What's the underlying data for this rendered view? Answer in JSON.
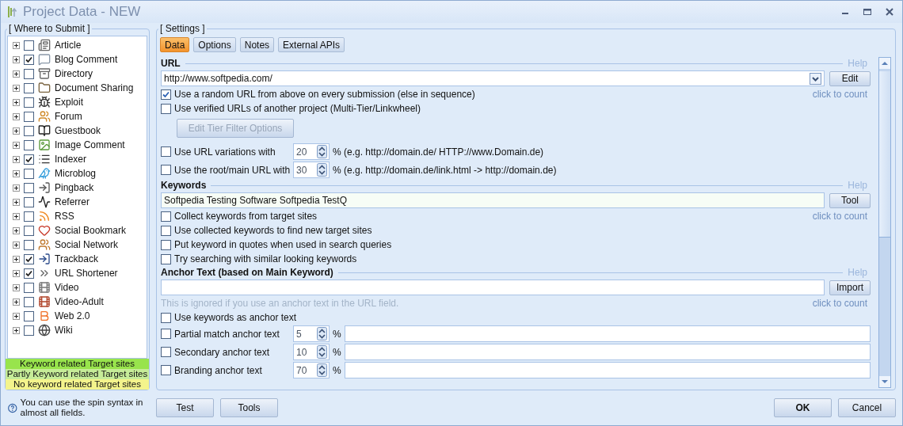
{
  "window": {
    "title": "Project Data - NEW"
  },
  "submit_panel": {
    "title": "[ Where to Submit ]",
    "items": [
      {
        "label": "Article",
        "checked": false
      },
      {
        "label": "Blog Comment",
        "checked": true
      },
      {
        "label": "Directory",
        "checked": false
      },
      {
        "label": "Document Sharing",
        "checked": false
      },
      {
        "label": "Exploit",
        "checked": false
      },
      {
        "label": "Forum",
        "checked": false
      },
      {
        "label": "Guestbook",
        "checked": false
      },
      {
        "label": "Image Comment",
        "checked": false
      },
      {
        "label": "Indexer",
        "checked": true
      },
      {
        "label": "Microblog",
        "checked": false
      },
      {
        "label": "Pingback",
        "checked": false
      },
      {
        "label": "Referrer",
        "checked": false
      },
      {
        "label": "RSS",
        "checked": false
      },
      {
        "label": "Social Bookmark",
        "checked": false
      },
      {
        "label": "Social Network",
        "checked": false
      },
      {
        "label": "Trackback",
        "checked": true
      },
      {
        "label": "URL Shortener",
        "checked": true
      },
      {
        "label": "Video",
        "checked": false
      },
      {
        "label": "Video-Adult",
        "checked": false
      },
      {
        "label": "Web 2.0",
        "checked": false
      },
      {
        "label": "Wiki",
        "checked": false
      }
    ]
  },
  "legend": [
    {
      "label": "Keyword related Target sites",
      "color": "#98e44c"
    },
    {
      "label": "Partly Keyword related Target sites",
      "color": "#c6ec98"
    },
    {
      "label": "No keyword related Target sites",
      "color": "#f4f48c"
    }
  ],
  "hint": "You can use the spin syntax in almost all fields.",
  "settings": {
    "title": "[ Settings ]",
    "tabs": [
      {
        "label": "Data",
        "selected": true
      },
      {
        "label": "Options",
        "selected": false
      },
      {
        "label": "Notes",
        "selected": false
      },
      {
        "label": "External APIs",
        "selected": false
      }
    ],
    "url": {
      "heading": "URL",
      "help": "Help",
      "value": "http://www.softpedia.com/",
      "button": "Edit",
      "count": "click to count"
    },
    "url_options": [
      {
        "label": "Use a random URL from above on every submission (else in sequence)",
        "checked": true
      },
      {
        "label": "Use verified URLs of another project (Multi-Tier/Linkwheel)",
        "checked": false
      }
    ],
    "tier_button": {
      "label": "Edit Tier Filter Options",
      "disabled": true
    },
    "url_percent": [
      {
        "label": "Use URL variations with",
        "checked": false,
        "value": "20",
        "note": "% (e.g. http://domain.de/ HTTP://www.Domain.de)"
      },
      {
        "label": "Use the root/main URL with",
        "checked": false,
        "value": "30",
        "note": "% (e.g. http://domain.de/link.html -> http://domain.de)"
      }
    ],
    "keywords": {
      "heading": "Keywords",
      "help": "Help",
      "value": "Softpedia Testing Software Softpedia TestQ",
      "button": "Tool",
      "count": "click to count"
    },
    "keyword_options": [
      {
        "label": "Collect keywords from target sites",
        "checked": false
      },
      {
        "label": "Use collected keywords to find new target sites",
        "checked": false
      },
      {
        "label": "Put keyword in quotes when used in search queries",
        "checked": false
      },
      {
        "label": "Try searching with similar looking keywords",
        "checked": false
      }
    ],
    "anchor": {
      "heading": "Anchor Text (based on Main Keyword)",
      "help": "Help",
      "button": "Import",
      "note": "This is ignored if you use an anchor text in the URL field.",
      "count": "click to count"
    },
    "anchor_option": {
      "label": "Use keywords as anchor text",
      "checked": false
    },
    "anchor_rows": [
      {
        "label": "Partial match anchor text",
        "checked": false,
        "value": "5",
        "unit": "%"
      },
      {
        "label": "Secondary anchor text",
        "checked": false,
        "value": "10",
        "unit": "%"
      },
      {
        "label": "Branding anchor text",
        "checked": false,
        "value": "70",
        "unit": "%"
      }
    ]
  },
  "footer": {
    "left_buttons": [
      "Test",
      "Tools"
    ],
    "right_buttons": [
      "OK",
      "Cancel"
    ]
  }
}
